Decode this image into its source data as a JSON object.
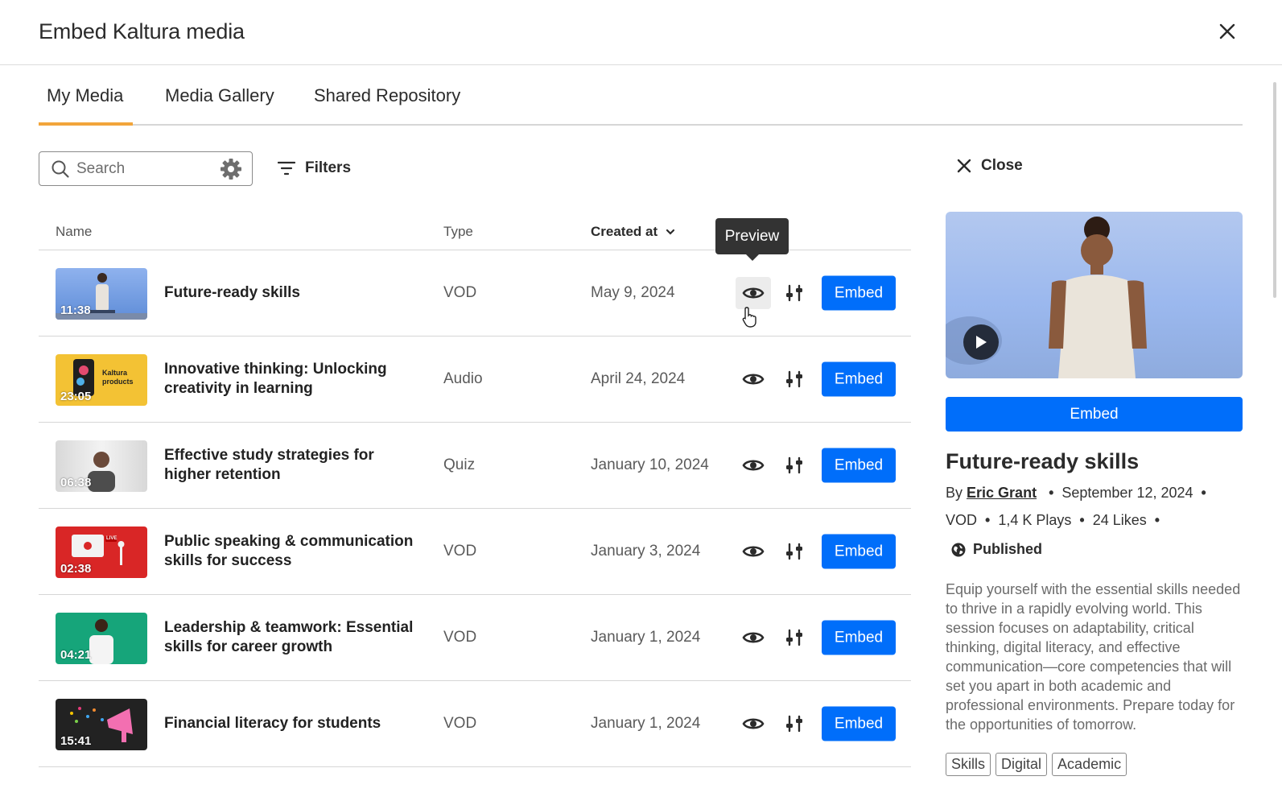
{
  "modal": {
    "title": "Embed Kaltura media"
  },
  "tabs": [
    {
      "label": "My Media",
      "active": true
    },
    {
      "label": "Media Gallery",
      "active": false
    },
    {
      "label": "Shared Repository",
      "active": false
    }
  ],
  "toolbar": {
    "search_placeholder": "Search",
    "filters_label": "Filters"
  },
  "table": {
    "columns": {
      "name": "Name",
      "type": "Type",
      "created": "Created at"
    },
    "embed_label": "Embed",
    "rows": [
      {
        "name": "Future-ready skills",
        "type": "VOD",
        "date": "May 9, 2024",
        "duration": "11:38"
      },
      {
        "name": "Innovative thinking: Unlocking creativity in learning",
        "type": "Audio",
        "date": "April 24, 2024",
        "duration": "23:05"
      },
      {
        "name": "Effective study strategies for higher retention",
        "type": "Quiz",
        "date": "January 10, 2024",
        "duration": "06:38"
      },
      {
        "name": "Public speaking & communication skills for success",
        "type": "VOD",
        "date": "January 3, 2024",
        "duration": "02:38"
      },
      {
        "name": "Leadership & teamwork: Essential skills for career growth",
        "type": "VOD",
        "date": "January 1, 2024",
        "duration": "04:21"
      },
      {
        "name": "Financial literacy for students",
        "type": "VOD",
        "date": "January 1, 2024",
        "duration": "15:41"
      }
    ]
  },
  "tooltip": {
    "label": "Preview"
  },
  "thumb_text": {
    "kaltura_products": "Kaltura products",
    "live": "LIVE"
  },
  "panel": {
    "close_label": "Close",
    "embed_label": "Embed",
    "title": "Future-ready skills",
    "by_label": "By",
    "author": "Eric Grant",
    "date": "September 12, 2024",
    "type": "VOD",
    "plays": "1,4 K Plays",
    "likes": "24 Likes",
    "status": "Published",
    "description": "Equip yourself with the essential skills needed to thrive in a rapidly evolving world. This session focuses on adaptability, critical thinking, digital literacy, and effective communication—core competencies that will set you apart in both academic and professional environments. Prepare today for the opportunities of tomorrow.",
    "tags": [
      "Skills",
      "Digital",
      "Academic"
    ]
  },
  "colors": {
    "primary": "#006efa",
    "tab_accent": "#f2a53b",
    "tooltip_bg": "#333333"
  }
}
